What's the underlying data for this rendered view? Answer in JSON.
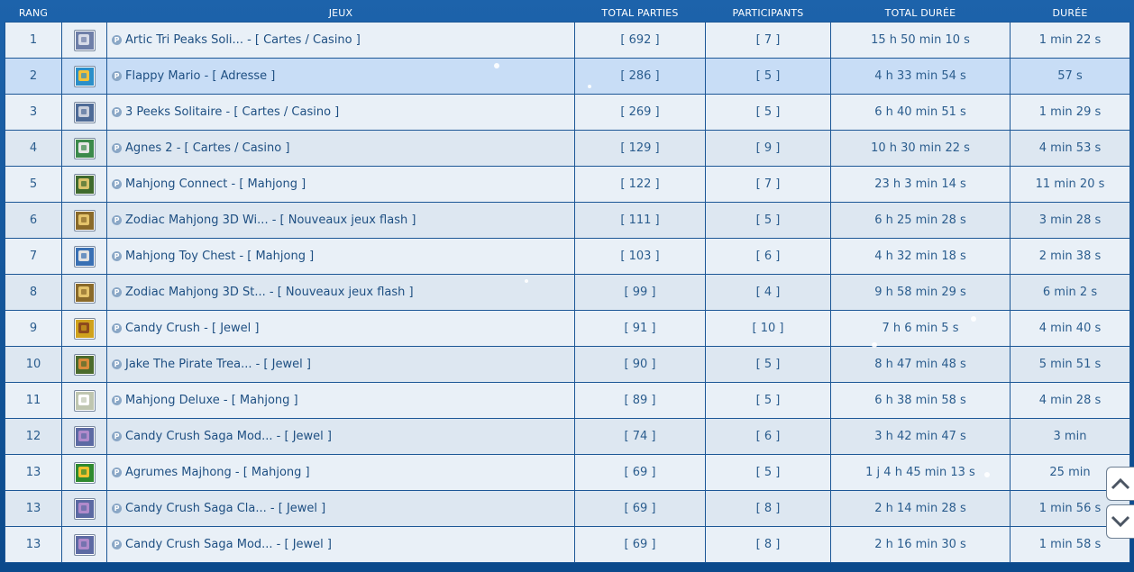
{
  "header": {
    "rank": "RANG",
    "games": "JEUX",
    "total_games": "TOTAL PARTIES",
    "participants": "PARTICIPANTS",
    "total_duration": "TOTAL DURÉE",
    "duration": "DURÉE"
  },
  "rows": [
    {
      "rank": "1",
      "game": "Artic Tri Peaks Soli... - [ Cartes / Casino ]",
      "total": "[ 692 ]",
      "participants": "[ 7 ]",
      "total_duration": "15 h 50 min 10 s",
      "duration": "1 min 22 s"
    },
    {
      "rank": "2",
      "game": "Flappy Mario - [ Adresse ]",
      "total": "[ 286 ]",
      "participants": "[ 5 ]",
      "total_duration": "4 h 33 min 54 s",
      "duration": "57 s"
    },
    {
      "rank": "3",
      "game": "3 Peeks Solitaire - [ Cartes / Casino ]",
      "total": "[ 269 ]",
      "participants": "[ 5 ]",
      "total_duration": "6 h 40 min 51 s",
      "duration": "1 min 29 s"
    },
    {
      "rank": "4",
      "game": "Agnes 2 - [ Cartes / Casino ]",
      "total": "[ 129 ]",
      "participants": "[ 9 ]",
      "total_duration": "10 h 30 min 22 s",
      "duration": "4 min 53 s"
    },
    {
      "rank": "5",
      "game": "Mahjong Connect - [ Mahjong ]",
      "total": "[ 122 ]",
      "participants": "[ 7 ]",
      "total_duration": "23 h 3 min 14 s",
      "duration": "11 min 20 s"
    },
    {
      "rank": "6",
      "game": "Zodiac Mahjong 3D Wi... - [ Nouveaux jeux flash ]",
      "total": "[ 111 ]",
      "participants": "[ 5 ]",
      "total_duration": "6 h 25 min 28 s",
      "duration": "3 min 28 s"
    },
    {
      "rank": "7",
      "game": "Mahjong Toy Chest - [ Mahjong ]",
      "total": "[ 103 ]",
      "participants": "[ 6 ]",
      "total_duration": "4 h 32 min 18 s",
      "duration": "2 min 38 s"
    },
    {
      "rank": "8",
      "game": "Zodiac Mahjong 3D St... - [ Nouveaux jeux flash ]",
      "total": "[ 99 ]",
      "participants": "[ 4 ]",
      "total_duration": "9 h 58 min 29 s",
      "duration": "6 min 2 s"
    },
    {
      "rank": "9",
      "game": "Candy Crush - [ Jewel ]",
      "total": "[ 91 ]",
      "participants": "[ 10 ]",
      "total_duration": "7 h 6 min 5 s",
      "duration": "4 min 40 s"
    },
    {
      "rank": "10",
      "game": "Jake The Pirate Trea... - [ Jewel ]",
      "total": "[ 90 ]",
      "participants": "[ 5 ]",
      "total_duration": "8 h 47 min 48 s",
      "duration": "5 min 51 s"
    },
    {
      "rank": "11",
      "game": "Mahjong Deluxe - [ Mahjong ]",
      "total": "[ 89 ]",
      "participants": "[ 5 ]",
      "total_duration": "6 h 38 min 58 s",
      "duration": "4 min 28 s"
    },
    {
      "rank": "12",
      "game": "Candy Crush Saga Mod... - [ Jewel ]",
      "total": "[ 74 ]",
      "participants": "[ 6 ]",
      "total_duration": "3 h 42 min 47 s",
      "duration": "3 min"
    },
    {
      "rank": "13",
      "game": "Agrumes Majhong - [ Mahjong ]",
      "total": "[ 69 ]",
      "participants": "[ 5 ]",
      "total_duration": "1 j 4 h 45 min 13 s",
      "duration": "25 min"
    },
    {
      "rank": "13",
      "game": "Candy Crush Saga Cla... - [ Jewel ]",
      "total": "[ 69 ]",
      "participants": "[ 8 ]",
      "total_duration": "2 h 14 min 28 s",
      "duration": "1 min 56 s"
    },
    {
      "rank": "13",
      "game": "Candy Crush Saga Mod... - [ Jewel ]",
      "total": "[ 69 ]",
      "participants": "[ 8 ]",
      "total_duration": "2 h 16 min 30 s",
      "duration": "1 min 58 s"
    }
  ],
  "thumb_colors": [
    [
      "#6f7fa8",
      "#d7dbe8"
    ],
    [
      "#2b8fc9",
      "#f2c23a"
    ],
    [
      "#4e6b97",
      "#c9cfdc"
    ],
    [
      "#3c8a4b",
      "#e6e6e6"
    ],
    [
      "#3f6a2d",
      "#d9c26a"
    ],
    [
      "#8a6a2a",
      "#e4c36b"
    ],
    [
      "#3970b4",
      "#e2e2e2"
    ],
    [
      "#8a6a2a",
      "#e4c36b"
    ],
    [
      "#d0a21c",
      "#8d4a1d"
    ],
    [
      "#4b6b2c",
      "#d98b3a"
    ],
    [
      "#bfc6b0",
      "#ffffff"
    ],
    [
      "#5c6aa3",
      "#b08acb"
    ],
    [
      "#2f8a2f",
      "#f2c12e"
    ],
    [
      "#5c6aa3",
      "#b08acb"
    ],
    [
      "#5c6aa3",
      "#b08acb"
    ]
  ],
  "highlight_row": 2,
  "nav": {
    "up_icon": "chevron-up-icon",
    "down_icon": "chevron-down-icon"
  }
}
